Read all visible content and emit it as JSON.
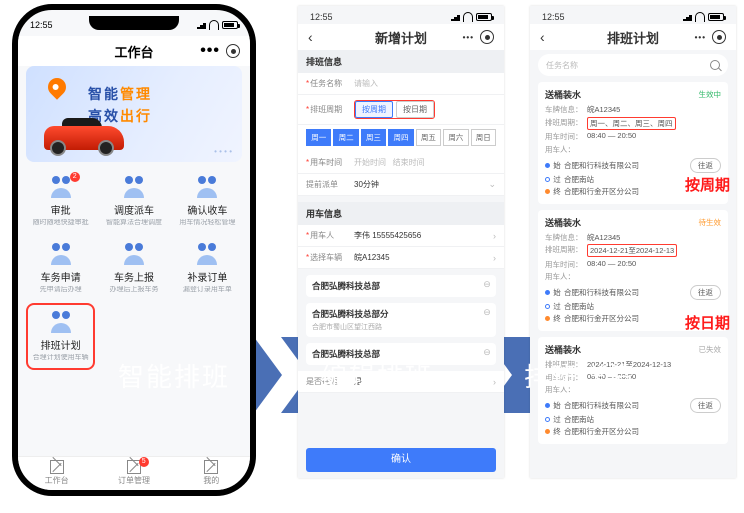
{
  "statusbar": {
    "time": "12:55"
  },
  "left": {
    "title": "工作台",
    "banner": {
      "l1a": "智能",
      "l1b": "管理",
      "l2a": "高效",
      "l2b": "出行"
    },
    "grid": [
      {
        "name": "审批",
        "sub": "随时随地快捷审批",
        "badge": "2"
      },
      {
        "name": "调度派车",
        "sub": "智能算法合理调度"
      },
      {
        "name": "确认收车",
        "sub": "用车情况轻松管理"
      },
      {
        "name": "车务申请",
        "sub": "先申请后办理"
      },
      {
        "name": "车务上报",
        "sub": "办理后上报车务"
      },
      {
        "name": "补录订单",
        "sub": "漏登订录用车单"
      },
      {
        "name": "排班计划",
        "sub": "合理计划使用车辆",
        "highlight": true
      }
    ],
    "tabs": [
      {
        "label": "工作台"
      },
      {
        "label": "订单管理",
        "badge": "5"
      },
      {
        "label": "我的"
      }
    ]
  },
  "mid": {
    "title": "新增计划",
    "section1": "排班信息",
    "rows": {
      "taskName": {
        "label": "任务名称",
        "ph": "请输入"
      },
      "cycle": {
        "label": "排班周期",
        "opts": [
          "按周期",
          "按日期"
        ]
      },
      "weekdays": [
        "周一",
        "周二",
        "周三",
        "周四",
        "周五",
        "周六",
        "周日"
      ],
      "timeRange": {
        "label": "用车时间",
        "ph1": "开始时间",
        "ph2": "结束时间"
      },
      "interval": {
        "label": "提前派单",
        "val": "30分钟"
      }
    },
    "section2": "用车信息",
    "rows2": {
      "person": {
        "label": "用车人",
        "val": "李伟 15555425656"
      },
      "vehicle": {
        "label": "选择车辆",
        "val": "皖A12345"
      }
    },
    "stops": [
      {
        "name": "合肥弘腾科技总部",
        "sub": ""
      },
      {
        "name": "合肥弘腾科技总部分",
        "sub": "合肥市蜀山区望江西路"
      },
      {
        "name": "合肥弘腾科技总部",
        "sub": ""
      }
    ],
    "roundtrip": {
      "label": "是否往返",
      "val": "是"
    },
    "confirm": "确认"
  },
  "right": {
    "title": "排班计划",
    "searchPh": "任务名称",
    "annotations": {
      "byCycle": "按周期",
      "byDate": "按日期"
    },
    "cards": [
      {
        "title": "送桶装水",
        "status": "生效中",
        "statusCls": "green",
        "vehicle": "皖A12345",
        "cycle": "周一、周二、周三、周四",
        "cycleBoxed": true,
        "time": "08:40 — 20:50",
        "driver": "",
        "route": [
          "合肥和行科技有限公司",
          "合肥南站",
          "合肥和行金开区分公司"
        ],
        "btn": "往返"
      },
      {
        "title": "送桶装水",
        "status": "待生效",
        "statusCls": "orange",
        "vehicle": "皖A12345",
        "cycle": "2024-12-21至2024-12-13",
        "cycleBoxed": true,
        "time": "08:40 — 20:50",
        "driver": "",
        "route": [
          "合肥和行科技有限公司",
          "合肥南站",
          "合肥和行金开区分公司"
        ],
        "btn": "往返"
      },
      {
        "title": "送桶装水",
        "status": "已失效",
        "statusCls": "gray",
        "vehicle": "",
        "cycle": "2024-12-21至2024-12-13",
        "time": "08:40 — 20:50",
        "driver": "",
        "route": [
          "合肥和行科技有限公司",
          "合肥南站",
          "合肥和行金开区分公司"
        ],
        "btn": "往返"
      }
    ]
  },
  "flow": {
    "s1": "智能排班",
    "s2": "编辑排班",
    "s3": "排班详情"
  }
}
